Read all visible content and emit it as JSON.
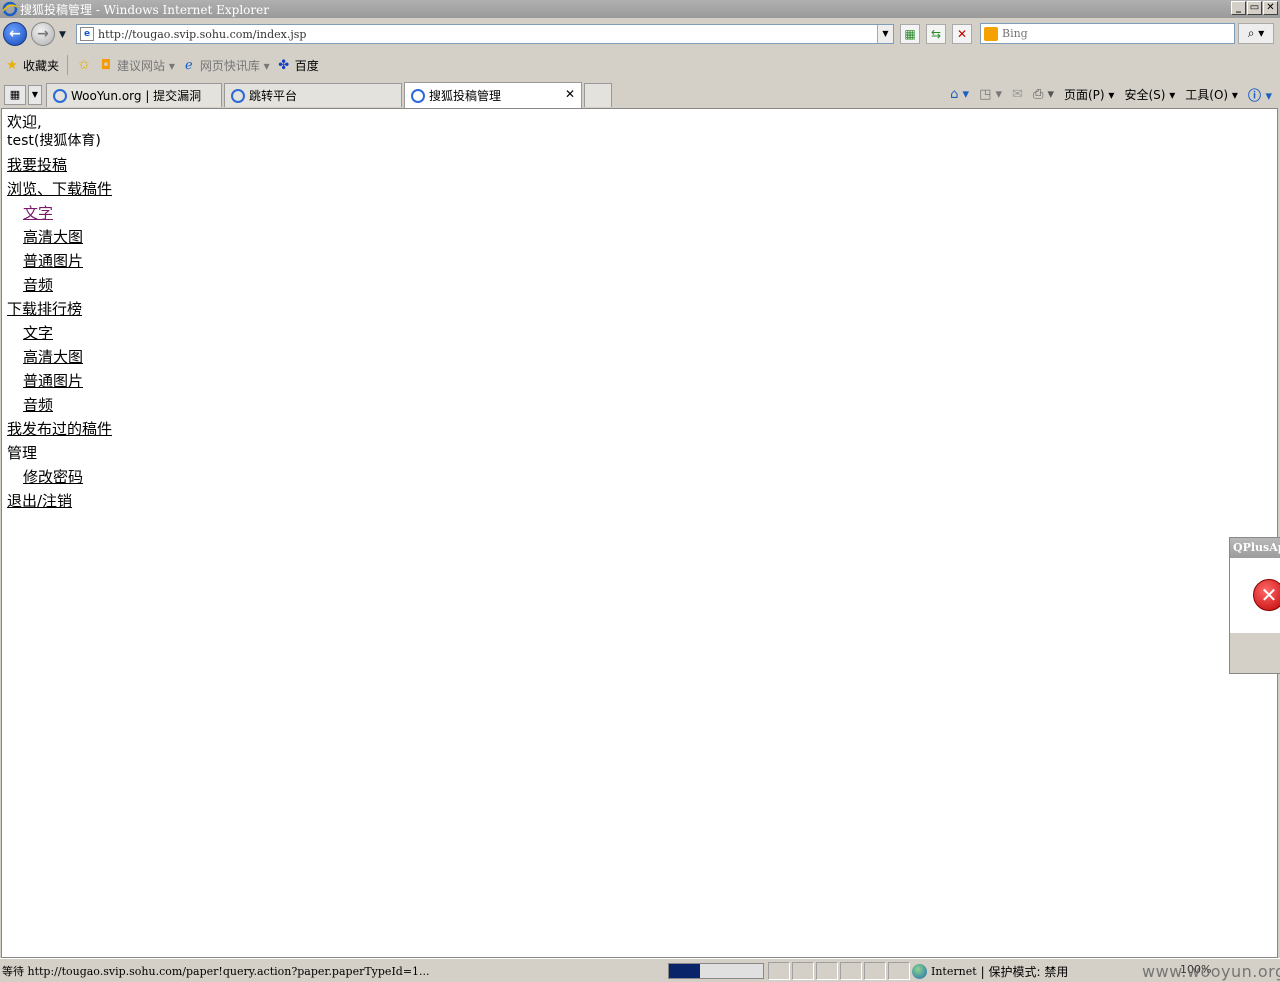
{
  "window": {
    "title": "搜狐投稿管理 - Windows Internet Explorer",
    "buttons": [
      "_",
      "▭",
      "✕"
    ]
  },
  "address": {
    "url": "http://tougao.svip.sohu.com/index.jsp"
  },
  "search": {
    "placeholder": "Bing"
  },
  "favorites": {
    "label": "收藏夹",
    "items": [
      {
        "label": "建议网站 ▾"
      },
      {
        "label": "网页快讯库 ▾"
      },
      {
        "label": "百度"
      }
    ]
  },
  "tabs": [
    {
      "label": "WooYun.org | 提交漏洞"
    },
    {
      "label": "跳转平台"
    },
    {
      "label": "搜狐投稿管理"
    }
  ],
  "command_bar": {
    "page": "页面(P) ▾",
    "safety": "安全(S) ▾",
    "tools": "工具(O) ▾"
  },
  "page": {
    "welcome": "欢迎,",
    "user": "test(搜狐体育)",
    "submit": "我要投稿",
    "browse": "浏览、下载稿件",
    "browse_items": [
      "文字",
      "高清大图",
      "普通图片",
      "音频"
    ],
    "ranking": "下载排行榜",
    "ranking_items": [
      "文字",
      "高清大图",
      "普通图片",
      "音频"
    ],
    "my_posts": "我发布过的稿件",
    "manage": "管理",
    "change_password": "修改密码",
    "logout": "退出/注销"
  },
  "popup": {
    "title": "QPlusAp"
  },
  "status": {
    "text": "等待 http://tougao.svip.sohu.com/paper!query.action?paper.paperTypeId=1...",
    "progress": 0.33,
    "zone": "Internet",
    "protected_mode": "| 保护模式: 禁用",
    "zoom": "100%"
  },
  "watermark": "www.wooyun.org"
}
